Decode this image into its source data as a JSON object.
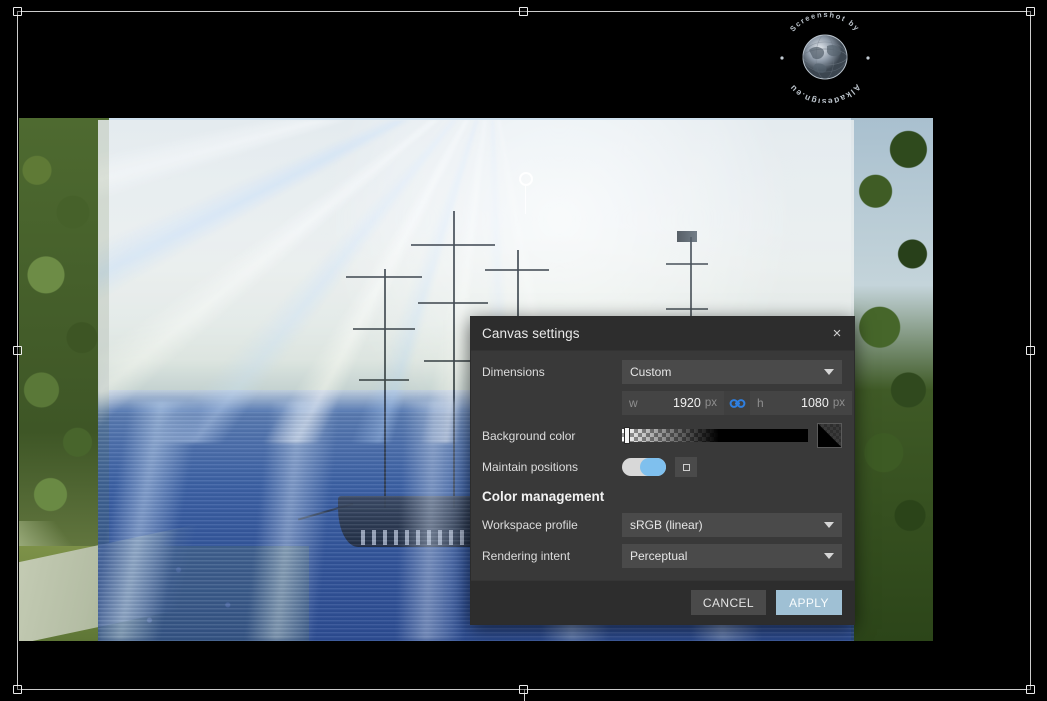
{
  "app": {
    "canvas_label": "image-canvas"
  },
  "watermark": {
    "top_text": "Screenshot by",
    "bottom_text": "Alkadesign.eu",
    "dot_left": "•",
    "dot_right": "•"
  },
  "dialog": {
    "title": "Canvas settings",
    "close_icon": "×",
    "rows": {
      "dimensions": {
        "label": "Dimensions",
        "value": "Custom",
        "options": [
          "Custom"
        ]
      },
      "size": {
        "w_key": "w",
        "w_value": "1920",
        "w_unit": "px",
        "h_key": "h",
        "h_value": "1080",
        "h_unit": "px",
        "link_icon": "link-icon",
        "link_color": "#2f7fe0"
      },
      "background_color": {
        "label": "Background color",
        "slider_value": "0",
        "swatch_color": "#000000"
      },
      "maintain_positions": {
        "label": "Maintain positions",
        "toggle_state": "on",
        "toggle_color": "#7fc0ee",
        "extra_button_icon": "square-icon"
      }
    },
    "color_management": {
      "section_title": "Color management",
      "workspace_profile": {
        "label": "Workspace profile",
        "value": "sRGB (linear)",
        "options": [
          "sRGB (linear)"
        ]
      },
      "rendering_intent": {
        "label": "Rendering intent",
        "value": "Perceptual",
        "options": [
          "Perceptual"
        ]
      }
    },
    "footer": {
      "cancel_label": "CANCEL",
      "apply_label": "APPLY",
      "apply_color": "#9fc0d4"
    }
  }
}
